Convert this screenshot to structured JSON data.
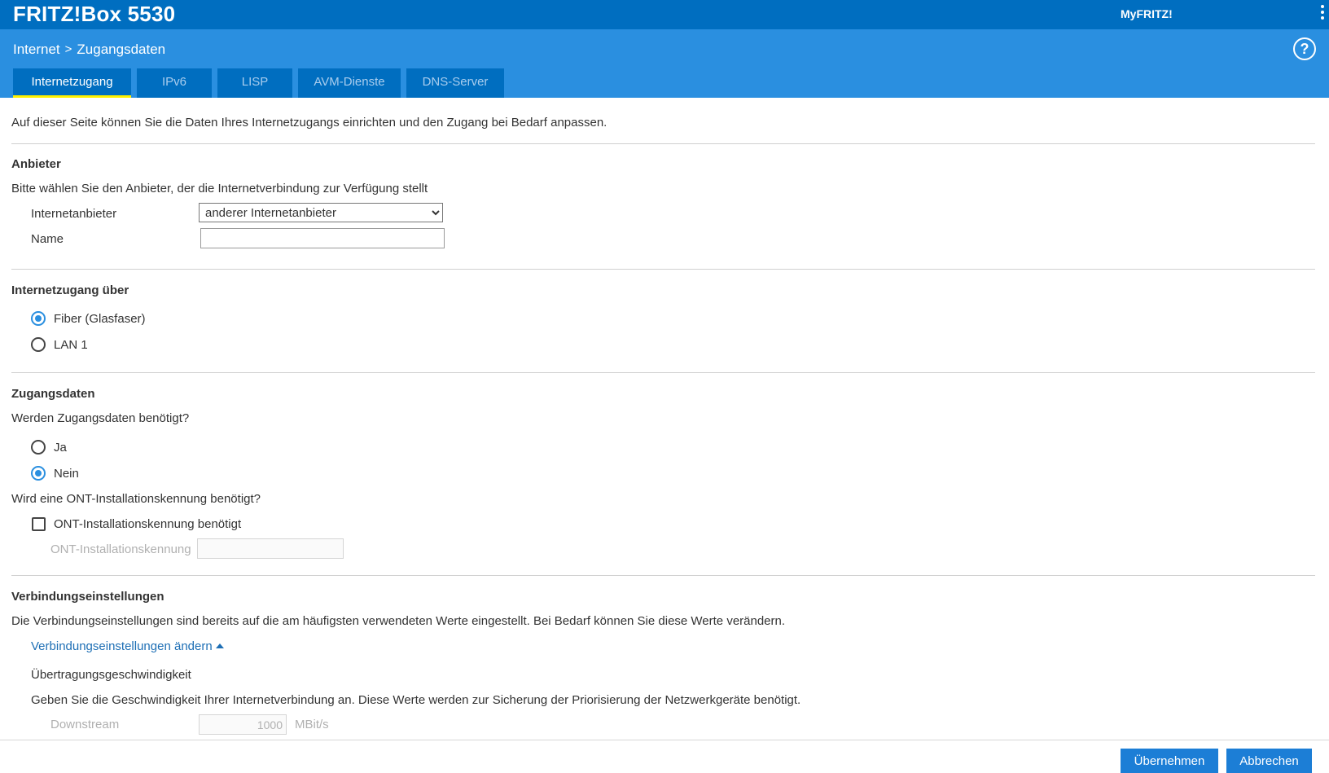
{
  "header": {
    "brand": "FRITZ!Box 5530",
    "myfritz": "MyFRITZ!",
    "help_glyph": "?"
  },
  "breadcrumb": {
    "section": "Internet",
    "page": "Zugangsdaten",
    "separator": ">"
  },
  "tabs": [
    {
      "label": "Internetzugang",
      "active": true
    },
    {
      "label": "IPv6",
      "active": false
    },
    {
      "label": "LISP",
      "active": false
    },
    {
      "label": "AVM-Dienste",
      "active": false
    },
    {
      "label": "DNS-Server",
      "active": false
    }
  ],
  "intro": "Auf dieser Seite können Sie die Daten Ihres Internetzugangs einrichten und den Zugang bei Bedarf anpassen.",
  "provider": {
    "heading": "Anbieter",
    "description": "Bitte wählen Sie den Anbieter, der die Internetverbindung zur Verfügung stellt",
    "provider_label": "Internetanbieter",
    "provider_value": "anderer Internetanbieter",
    "name_label": "Name",
    "name_value": ""
  },
  "access": {
    "heading": "Internetzugang über",
    "options": [
      {
        "label": "Fiber (Glasfaser)",
        "selected": true
      },
      {
        "label": "LAN 1",
        "selected": false
      }
    ]
  },
  "credentials": {
    "heading": "Zugangsdaten",
    "question": "Werden Zugangsdaten benötigt?",
    "options": [
      {
        "label": "Ja",
        "selected": false
      },
      {
        "label": "Nein",
        "selected": true
      }
    ],
    "ont_question": "Wird eine ONT-Installationskennung benötigt?",
    "ont_checkbox_label": "ONT-Installationskennung benötigt",
    "ont_checked": false,
    "ont_field_label": "ONT-Installationskennung",
    "ont_field_value": ""
  },
  "connection": {
    "heading": "Verbindungseinstellungen",
    "description": "Die Verbindungseinstellungen sind bereits auf die am häufigsten verwendeten Werte eingestellt. Bei Bedarf können Sie diese Werte verändern.",
    "toggle_link": "Verbindungseinstellungen ändern",
    "speed_heading": "Übertragungsgeschwindigkeit",
    "speed_description": "Geben Sie die Geschwindigkeit Ihrer Internetverbindung an. Diese Werte werden zur Sicherung der Priorisierung der Netzwerkgeräte benötigt.",
    "downstream_label": "Downstream",
    "downstream_value": "1000",
    "unit": "MBit/s"
  },
  "footer": {
    "apply_label": "Übernehmen",
    "cancel_label": "Abbrechen"
  },
  "colors": {
    "topbar": "#006ec0",
    "subbar": "#2a8fe0",
    "tab_indicator": "#fff100",
    "button": "#1c7ed6",
    "link": "#1e6fb5"
  }
}
